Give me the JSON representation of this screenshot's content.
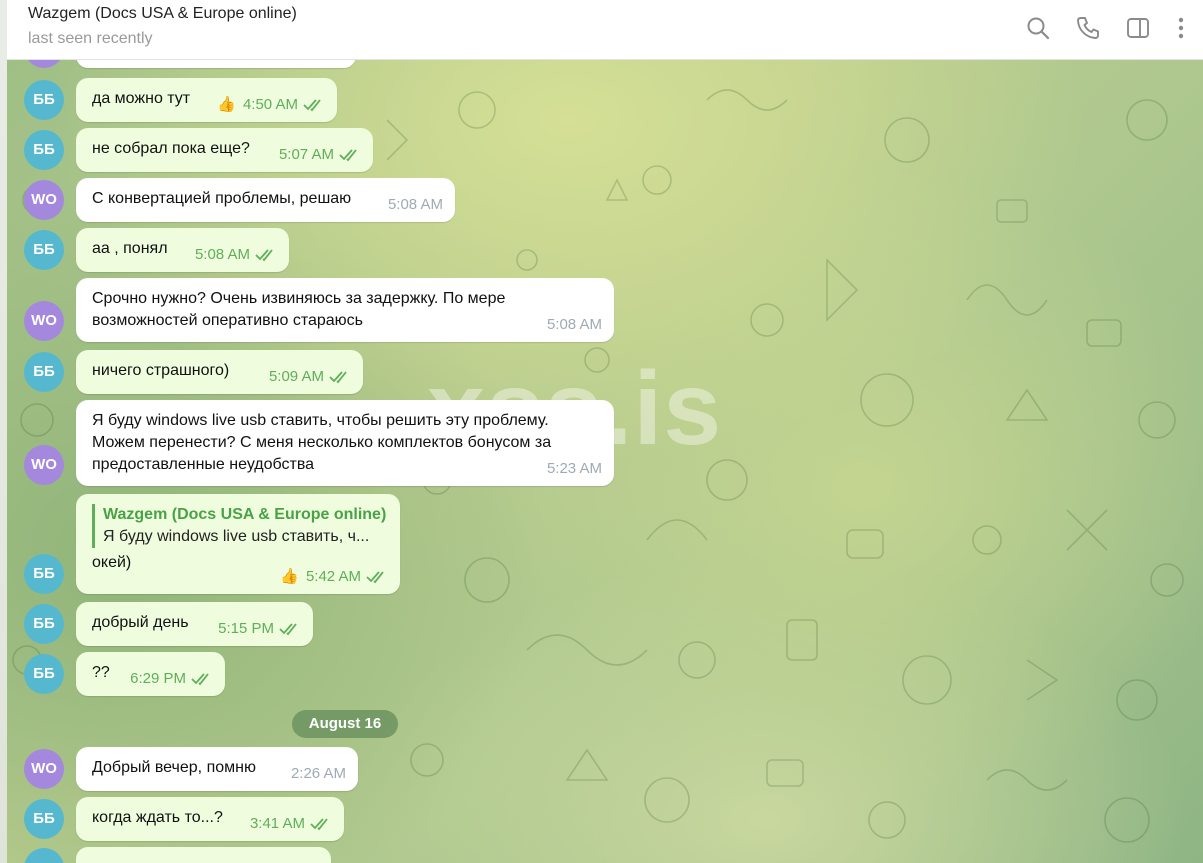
{
  "header": {
    "title": "Wazgem (Docs USA & Europe online)",
    "status": "last seen recently",
    "icons": [
      "search-icon",
      "phone-icon",
      "sidebar-toggle-icon",
      "more-icon"
    ]
  },
  "watermark": "xss.is",
  "date_separator": "August 16",
  "avatars": {
    "bb": "ББ",
    "wo": "WO"
  },
  "reply_quote": {
    "name": "Wazgem (Docs USA & Europe online)",
    "text": "Я буду windows live usb ставить, ч..."
  },
  "messages": [
    {
      "text": "да можно тут",
      "time": "4:50 AM",
      "reaction": "👍"
    },
    {
      "text": "не собрал пока еще?",
      "time": "5:07 AM"
    },
    {
      "text": "С конвертацией проблемы, решаю",
      "time": "5:08 AM"
    },
    {
      "text": "аа , понял",
      "time": "5:08 AM"
    },
    {
      "line1": "Срочно нужно? Очень извиняюсь за задержку. По мере",
      "line2": "возможностей оперативно стараюсь",
      "time": "5:08 AM"
    },
    {
      "text": "ничего страшного)",
      "time": "5:09 AM"
    },
    {
      "line1": "Я буду windows live usb ставить, чтобы решить эту проблему.",
      "line2": "Можем перенести? С меня несколько комплектов бонусом за",
      "line3": "предоставленные неудобства",
      "time": "5:23 AM"
    },
    {
      "text": "окей)",
      "time": "5:42 AM",
      "reaction": "👍"
    },
    {
      "text": "добрый день",
      "time": "5:15 PM"
    },
    {
      "text": "??",
      "time": "6:29 PM"
    },
    {
      "text": "Добрый вечер, помню",
      "time": "2:26 AM"
    },
    {
      "text": "когда ждать то...?",
      "time": "3:41 AM"
    }
  ]
}
